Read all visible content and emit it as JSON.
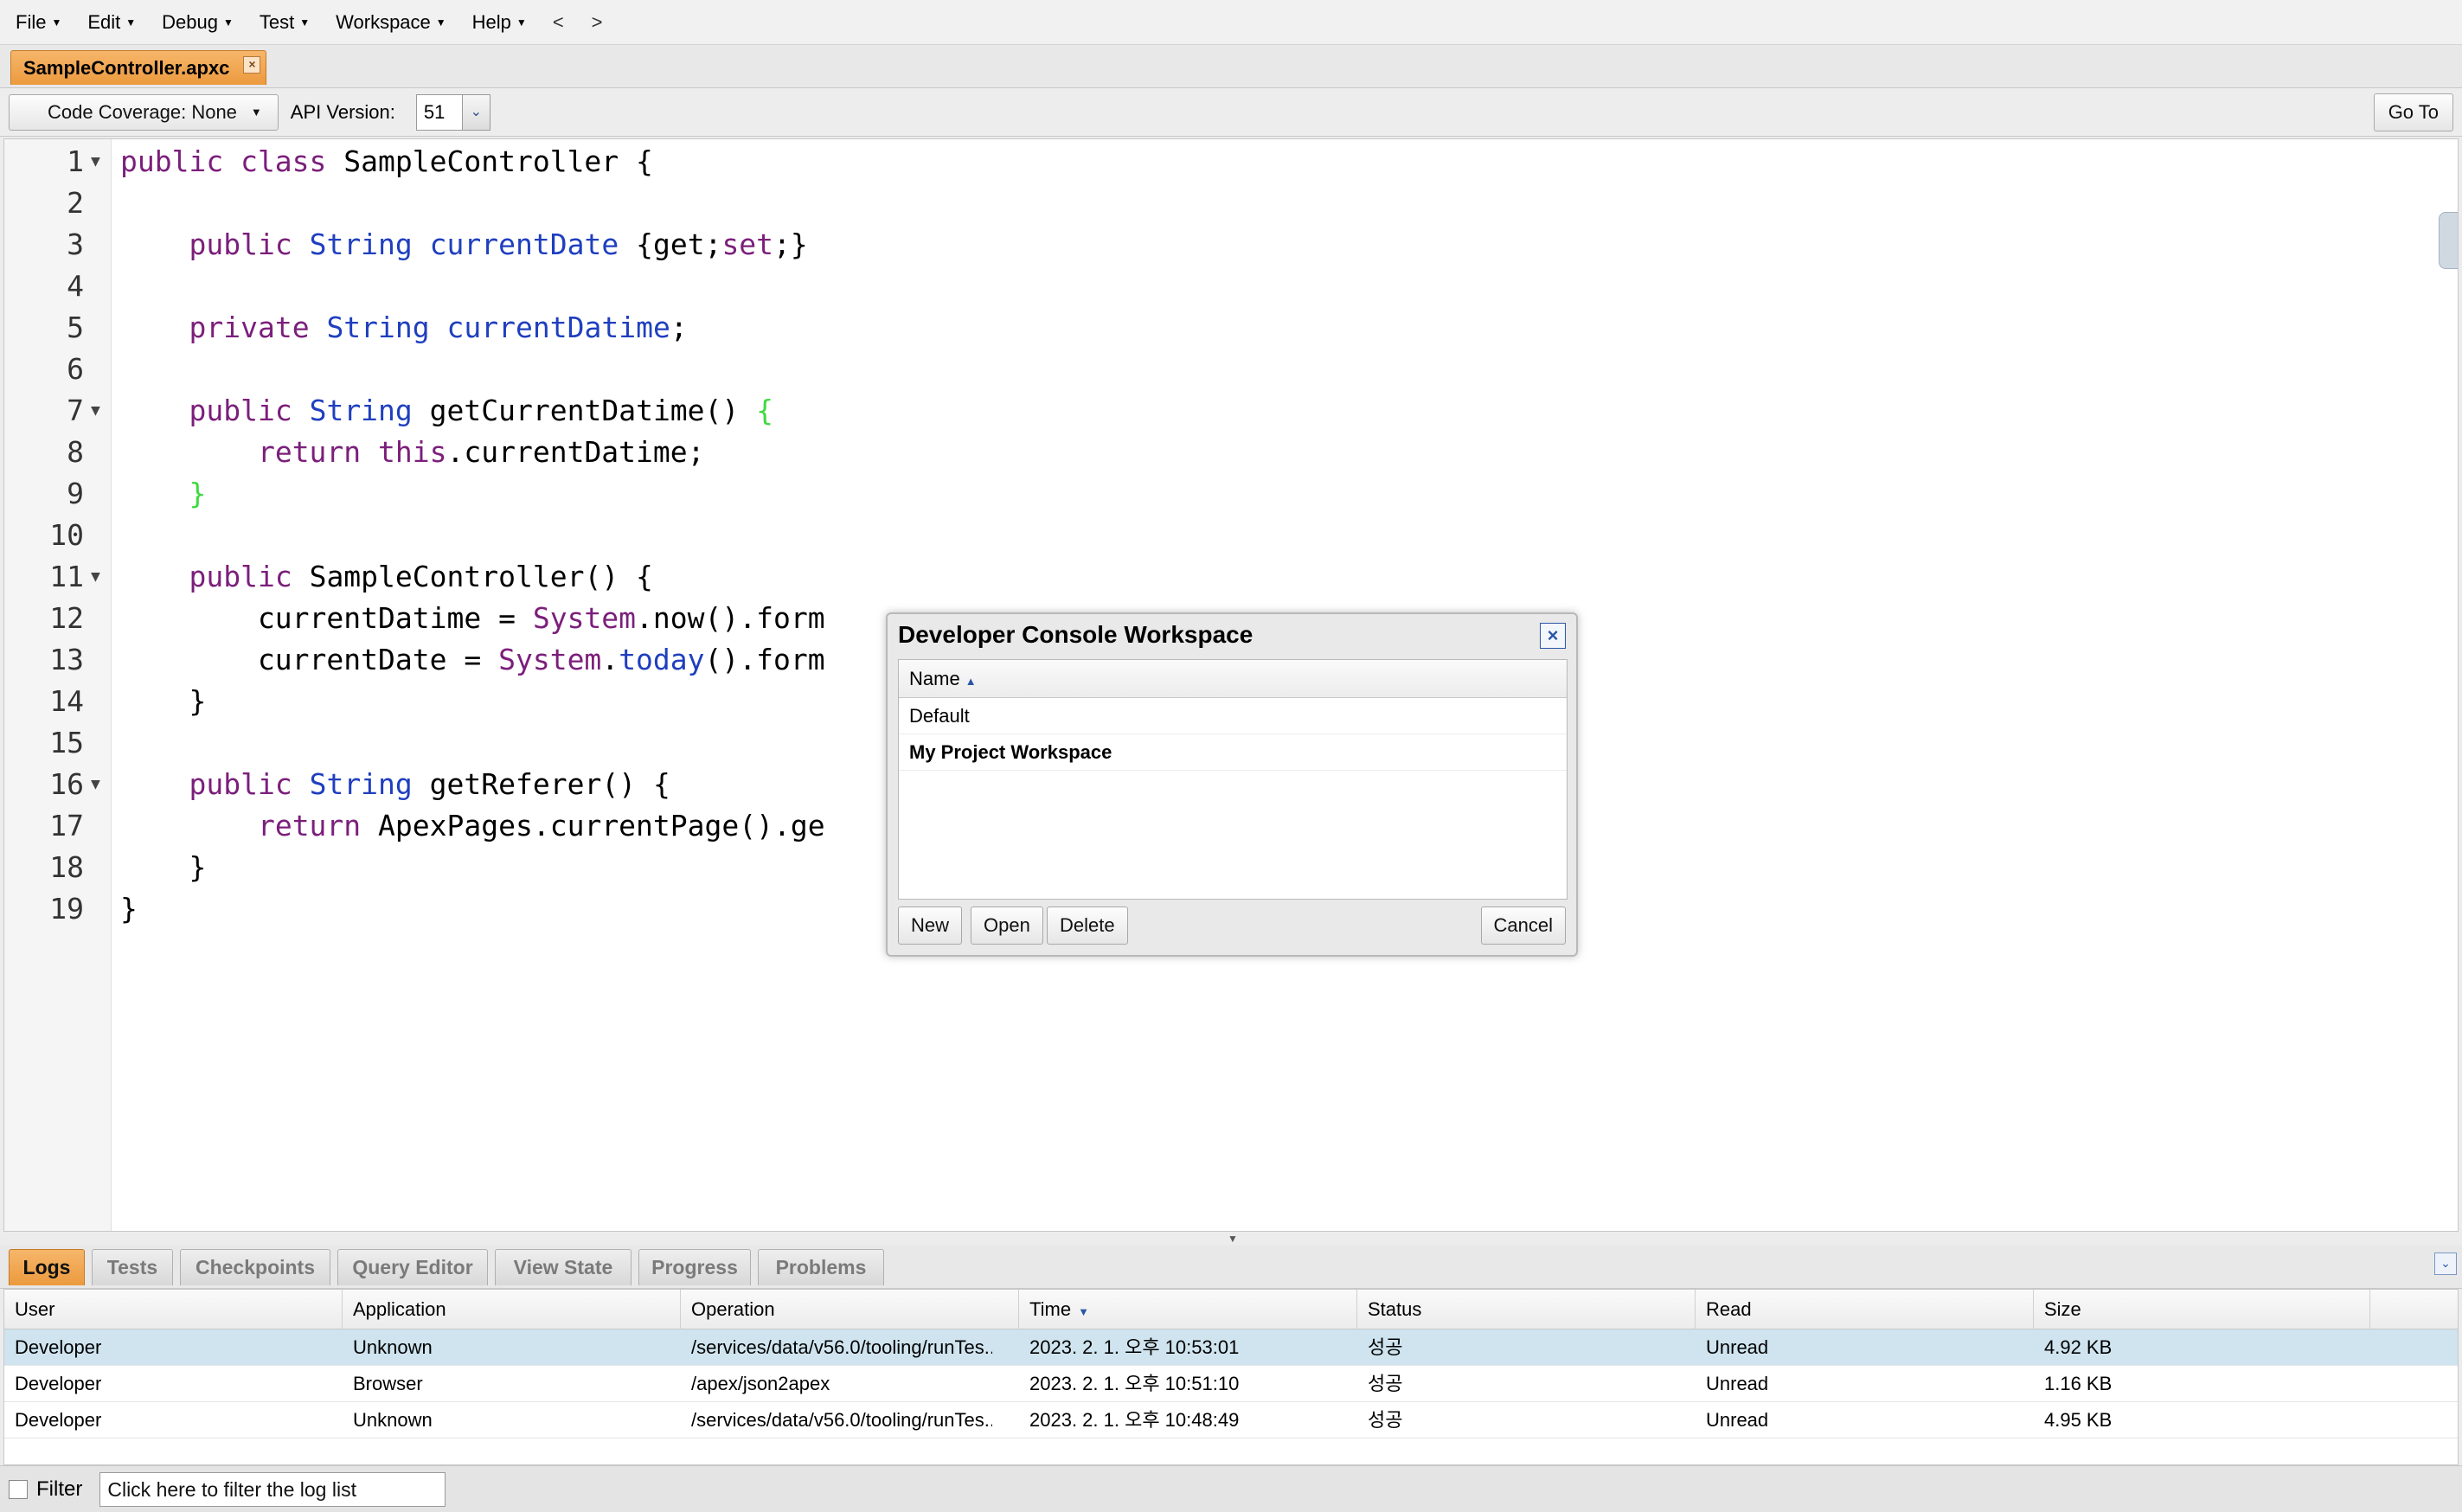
{
  "menubar": {
    "items": [
      "File",
      "Edit",
      "Debug",
      "Test",
      "Workspace",
      "Help"
    ],
    "back": "<",
    "forward": ">"
  },
  "file_tab": {
    "label": "SampleController.apxc"
  },
  "toolbar": {
    "coverage_label": "Code Coverage: None",
    "api_label": "API Version:",
    "api_value": "51",
    "goto_label": "Go To"
  },
  "editor": {
    "lines": [
      {
        "num": "1",
        "fold": "▼",
        "code": "<span class=\"kw\">public class</span> SampleController {"
      },
      {
        "num": "2",
        "fold": "",
        "code": ""
      },
      {
        "num": "3",
        "fold": "",
        "code": "    <span class=\"kw\">public</span> <span class=\"ty\">String</span> <span class=\"id\">currentDate</span> {get;<span class=\"kw\">set</span>;}"
      },
      {
        "num": "4",
        "fold": "",
        "code": ""
      },
      {
        "num": "5",
        "fold": "",
        "code": "    <span class=\"kw\">private</span> <span class=\"ty\">String</span> <span class=\"id\">currentDatime</span>;"
      },
      {
        "num": "6",
        "fold": "",
        "code": ""
      },
      {
        "num": "7",
        "fold": "▼",
        "code": "    <span class=\"kw\">public</span> <span class=\"ty\">String</span> getCurrentDatime() <span class=\"br\">{</span>"
      },
      {
        "num": "8",
        "fold": "",
        "code": "        <span class=\"kw\">return this</span>.currentDatime;"
      },
      {
        "num": "9",
        "fold": "",
        "code": "    <span class=\"br\">}</span>"
      },
      {
        "num": "10",
        "fold": "",
        "code": ""
      },
      {
        "num": "11",
        "fold": "▼",
        "code": "    <span class=\"kw\">public</span> SampleController() {"
      },
      {
        "num": "12",
        "fold": "",
        "code": "        currentDatime = <span class=\"sys\">System</span>.now().form"
      },
      {
        "num": "13",
        "fold": "",
        "code": "        currentDate = <span class=\"sys\">System</span>.<span class=\"id\">today</span>().form"
      },
      {
        "num": "14",
        "fold": "",
        "code": "    }"
      },
      {
        "num": "15",
        "fold": "",
        "code": ""
      },
      {
        "num": "16",
        "fold": "▼",
        "code": "    <span class=\"kw\">public</span> <span class=\"ty\">String</span> getReferer() {"
      },
      {
        "num": "17",
        "fold": "",
        "code": "        <span class=\"kw\">return</span> ApexPages.currentPage().ge"
      },
      {
        "num": "18",
        "fold": "",
        "code": "    }"
      },
      {
        "num": "19",
        "fold": "",
        "code": "}"
      }
    ]
  },
  "bottom_tabs": [
    "Logs",
    "Tests",
    "Checkpoints",
    "Query Editor",
    "View State",
    "Progress",
    "Problems"
  ],
  "logs": {
    "columns": [
      "User",
      "Application",
      "Operation",
      "Time",
      "Status",
      "Read",
      "Size"
    ],
    "rows": [
      [
        "Developer",
        "Unknown",
        "/services/data/v56.0/tooling/runTes...",
        "2023. 2. 1. 오후 10:53:01",
        "성공",
        "Unread",
        "4.92 KB"
      ],
      [
        "Developer",
        "Browser",
        "/apex/json2apex",
        "2023. 2. 1. 오후 10:51:10",
        "성공",
        "Unread",
        "1.16 KB"
      ],
      [
        "Developer",
        "Unknown",
        "/services/data/v56.0/tooling/runTes...",
        "2023. 2. 1. 오후 10:48:49",
        "성공",
        "Unread",
        "4.95 KB"
      ]
    ]
  },
  "filter": {
    "label": "Filter",
    "placeholder": "Click here to filter the log list"
  },
  "dialog": {
    "title": "Developer Console Workspace",
    "column": "Name",
    "workspaces": [
      "Default",
      "My Project Workspace"
    ],
    "buttons": {
      "new": "New",
      "open": "Open",
      "delete": "Delete",
      "cancel": "Cancel"
    }
  },
  "colors": {
    "active_tab": "#ec9a3e",
    "selected_row": "#cfe4ef",
    "keyword": "#7b1f7b",
    "type": "#1f3fbf",
    "bracket_match": "#3fd93f"
  }
}
